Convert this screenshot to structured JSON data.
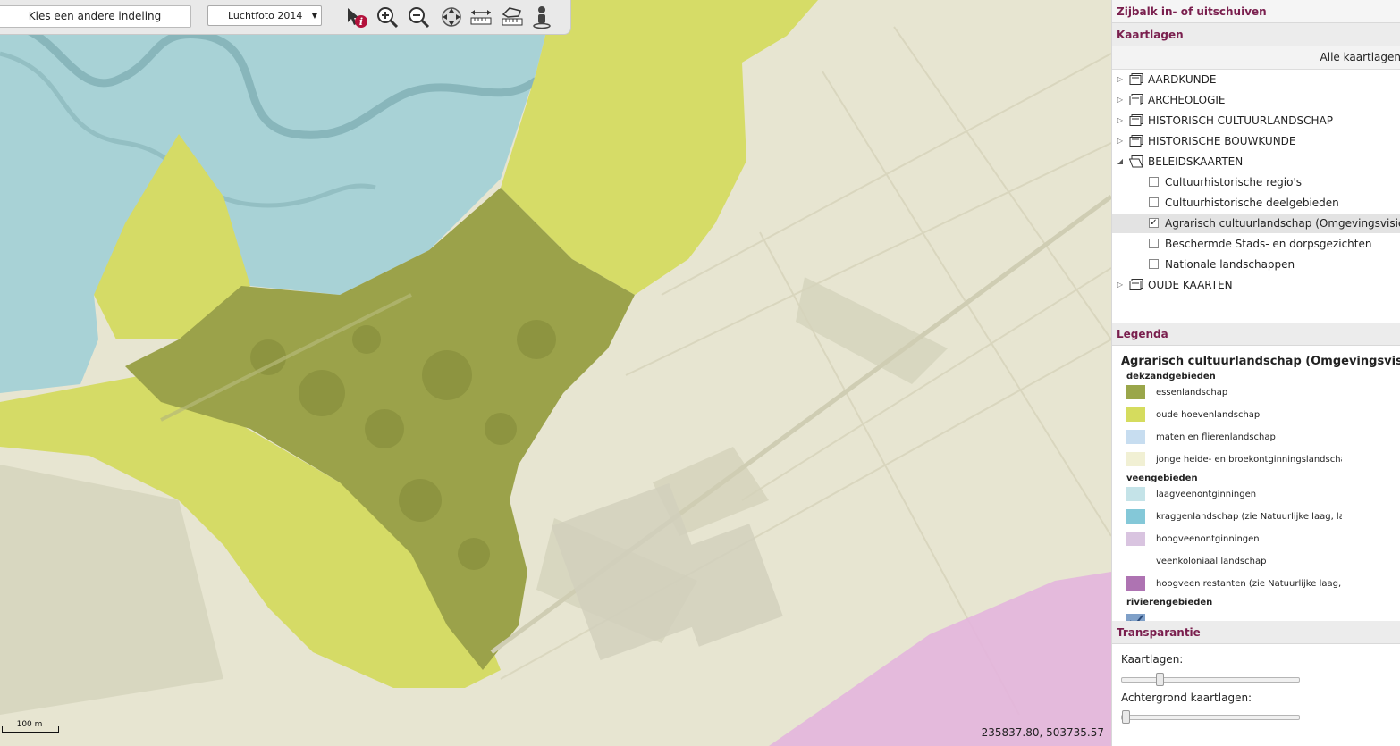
{
  "toolbar": {
    "layout_button": "Kies een andere indeling",
    "background_select": "Luchtfoto 2014",
    "tools": [
      {
        "name": "info-icon"
      },
      {
        "name": "zoom-in-icon"
      },
      {
        "name": "zoom-out-icon"
      },
      {
        "name": "pan-icon"
      },
      {
        "name": "measure-distance-icon"
      },
      {
        "name": "measure-area-icon"
      },
      {
        "name": "streetview-person-icon"
      }
    ]
  },
  "map": {
    "scale_label": "100 m",
    "coordinates": "235837.80, 503735.57"
  },
  "panel": {
    "toggle": "Zijbalk in- of uitschuiven",
    "layers_header": "Kaartlagen",
    "all_layers": "Alle kaartlagen",
    "tree": [
      {
        "label": "AARDKUNDE",
        "type": "folder",
        "expanded": false
      },
      {
        "label": "ARCHEOLOGIE",
        "type": "folder",
        "expanded": false
      },
      {
        "label": "HISTORISCH CULTUURLANDSCHAP",
        "type": "folder",
        "expanded": false
      },
      {
        "label": "HISTORISCHE BOUWKUNDE",
        "type": "folder",
        "expanded": false
      },
      {
        "label": "BELEIDSKAARTEN",
        "type": "folder",
        "expanded": true
      },
      {
        "label": "Cultuurhistorische regio's",
        "type": "layer",
        "checked": false
      },
      {
        "label": "Cultuurhistorische deelgebieden",
        "type": "layer",
        "checked": false
      },
      {
        "label": "Agrarisch cultuurlandschap (Omgevingsvisie)",
        "type": "layer",
        "checked": true
      },
      {
        "label": "Beschermde Stads- en dorpsgezichten",
        "type": "layer",
        "checked": false
      },
      {
        "label": "Nationale landschappen",
        "type": "layer",
        "checked": false
      },
      {
        "label": "OUDE KAARTEN",
        "type": "folder",
        "expanded": false
      }
    ],
    "legend_header": "Legenda",
    "legend_title": "Agrarisch cultuurlandschap (Omgevingsvisie)",
    "legend": [
      {
        "group": "dekzandgebieden"
      },
      {
        "label": "essenlandschap",
        "color": "#9aa64a"
      },
      {
        "label": "oude hoevenlandschap",
        "color": "#d5dc5e"
      },
      {
        "label": "maten en flierenlandschap",
        "color": "#c7ddf0"
      },
      {
        "label": "jonge heide- en broekontginningslandschap",
        "color": "#f1f0d4"
      },
      {
        "group": "veengebieden"
      },
      {
        "label": "laagveenontginningen",
        "color": "#c4e3e8"
      },
      {
        "label": "kraggenlandschap (zie Natuurlijke laag, laag)",
        "color": "#84c8d8"
      },
      {
        "label": "hoogveenontginningen",
        "color": "#d9c4e0"
      },
      {
        "label": "veenkoloniaal landschap",
        "color": ""
      },
      {
        "label": "hoogveen restanten (zie Natuurlijke laag, laag)",
        "color": "#ae73b2"
      },
      {
        "group": "rivierengebieden"
      }
    ],
    "transparency_header": "Transparantie",
    "transparency": [
      {
        "label": "Kaartlagen:",
        "value": 0.2
      },
      {
        "label": "Achtergrond kaartlagen:",
        "value": 0.0
      }
    ]
  }
}
